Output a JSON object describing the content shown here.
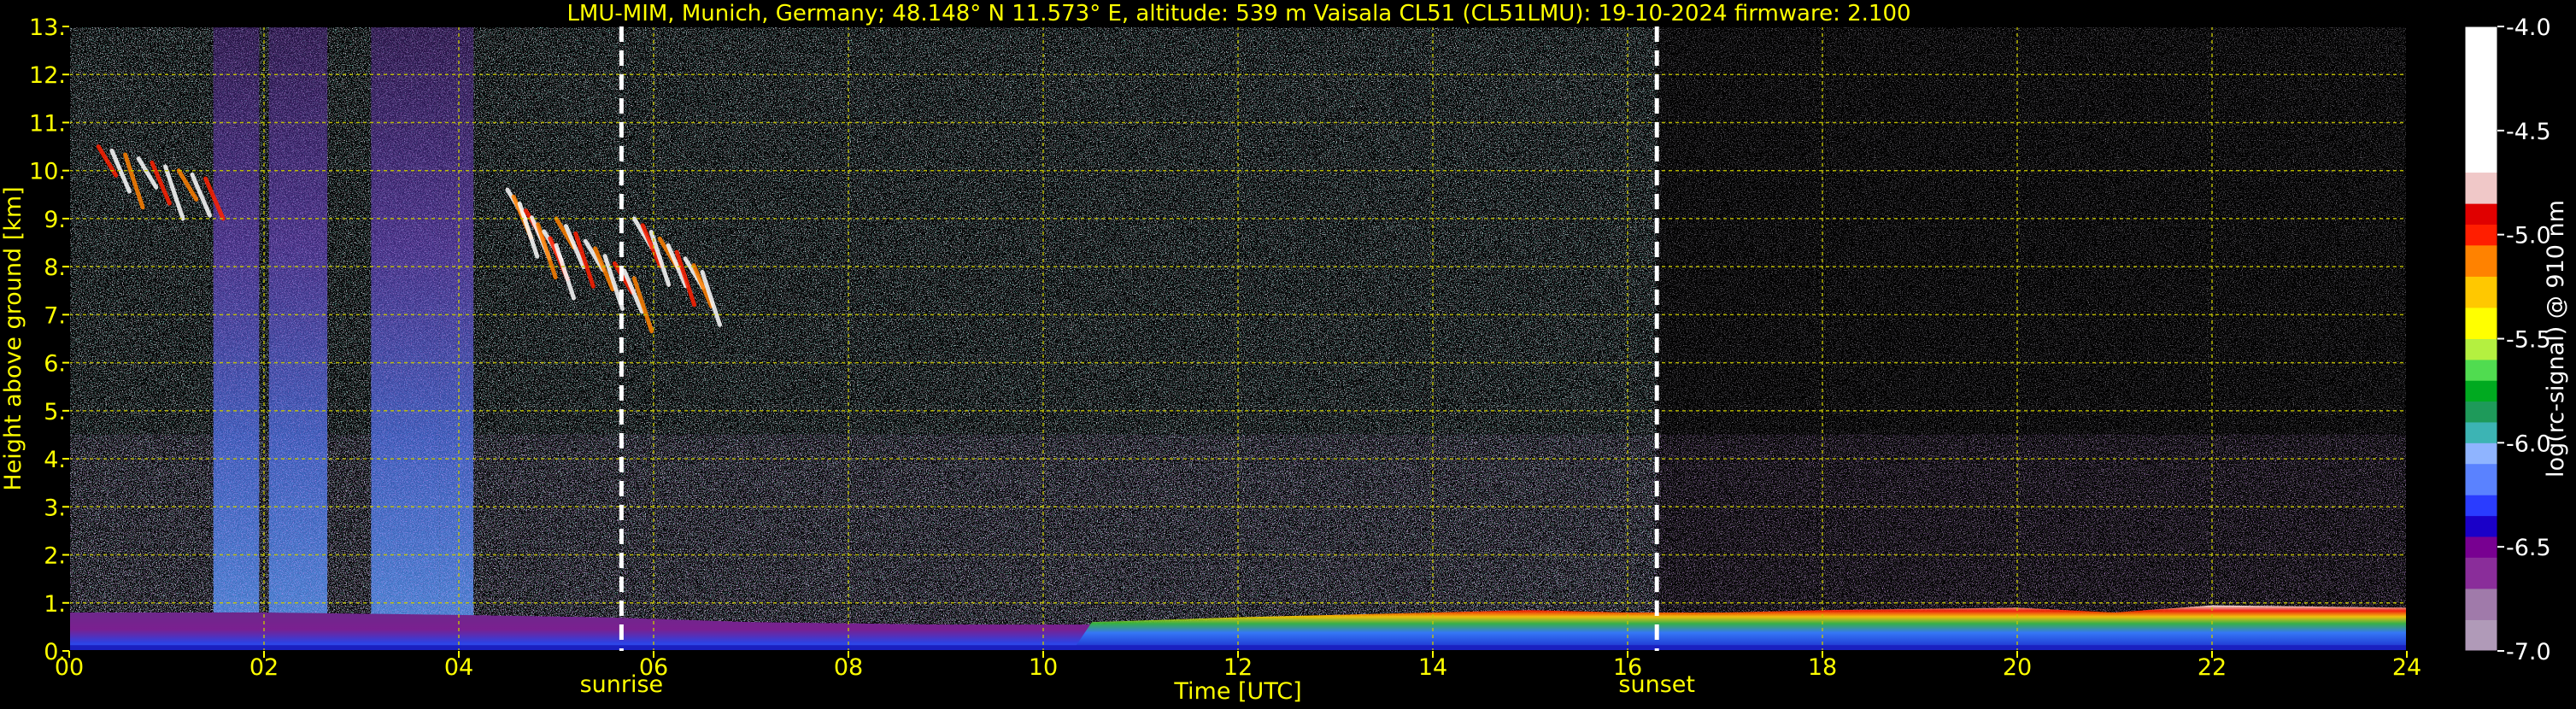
{
  "chart_data": {
    "type": "heatmap",
    "title": "LMU-MIM, Munich, Germany; 48.148° N 11.573° E, altitude: 539 m    Vaisala CL51 (CL51LMU): 19-10-2024    firmware: 2.100",
    "xlabel": "Time [UTC]",
    "ylabel": "Height above ground [km]",
    "xlim": [
      0,
      24
    ],
    "ylim": [
      0,
      13
    ],
    "xticks": [
      {
        "v": 0,
        "label": "00"
      },
      {
        "v": 2,
        "label": "02"
      },
      {
        "v": 4,
        "label": "04"
      },
      {
        "v": 6,
        "label": "06"
      },
      {
        "v": 8,
        "label": "08"
      },
      {
        "v": 10,
        "label": "10"
      },
      {
        "v": 12,
        "label": "12"
      },
      {
        "v": 14,
        "label": "14"
      },
      {
        "v": 16,
        "label": "16"
      },
      {
        "v": 18,
        "label": "18"
      },
      {
        "v": 20,
        "label": "20"
      },
      {
        "v": 22,
        "label": "22"
      },
      {
        "v": 24,
        "label": "24"
      }
    ],
    "yticks": [
      {
        "v": 0,
        "label": "0."
      },
      {
        "v": 1,
        "label": "1."
      },
      {
        "v": 2,
        "label": "2."
      },
      {
        "v": 3,
        "label": "3."
      },
      {
        "v": 4,
        "label": "4."
      },
      {
        "v": 5,
        "label": "5."
      },
      {
        "v": 6,
        "label": "6."
      },
      {
        "v": 7,
        "label": "7."
      },
      {
        "v": 8,
        "label": "8."
      },
      {
        "v": 9,
        "label": "9."
      },
      {
        "v": 10,
        "label": "10."
      },
      {
        "v": 11,
        "label": "11."
      },
      {
        "v": 12,
        "label": "12."
      },
      {
        "v": 13,
        "label": "13."
      }
    ],
    "grid": true,
    "markers": [
      {
        "label": "sunrise",
        "time": 5.67
      },
      {
        "label": "sunset",
        "time": 16.3
      }
    ],
    "colorbar": {
      "label": "log(rc-signal) @ 910 nm",
      "range": [
        -7.0,
        -4.0
      ],
      "ticks": [
        {
          "v": -4.0,
          "label": "-4.0"
        },
        {
          "v": -4.5,
          "label": "-4.5"
        },
        {
          "v": -5.0,
          "label": "-5.0"
        },
        {
          "v": -5.5,
          "label": "-5.5"
        },
        {
          "v": -6.0,
          "label": "-6.0"
        },
        {
          "v": -6.5,
          "label": "-6.5"
        },
        {
          "v": -7.0,
          "label": "-7.0"
        }
      ],
      "colors": [
        {
          "v": -7.0,
          "c": "#b09ab8"
        },
        {
          "v": -6.85,
          "c": "#a07aaa"
        },
        {
          "v": -6.7,
          "c": "#8a2d9a"
        },
        {
          "v": -6.55,
          "c": "#780091"
        },
        {
          "v": -6.45,
          "c": "#1a00c8"
        },
        {
          "v": -6.35,
          "c": "#2a3cff"
        },
        {
          "v": -6.25,
          "c": "#5a82ff"
        },
        {
          "v": -6.1,
          "c": "#8fb4ff"
        },
        {
          "v": -6.0,
          "c": "#3cb4b4"
        },
        {
          "v": -5.9,
          "c": "#1e9a5a"
        },
        {
          "v": -5.8,
          "c": "#00aa20"
        },
        {
          "v": -5.7,
          "c": "#50dc50"
        },
        {
          "v": -5.6,
          "c": "#b4f040"
        },
        {
          "v": -5.5,
          "c": "#ffff00"
        },
        {
          "v": -5.35,
          "c": "#ffc800"
        },
        {
          "v": -5.2,
          "c": "#ff8200"
        },
        {
          "v": -5.05,
          "c": "#ff1e00"
        },
        {
          "v": -4.95,
          "c": "#e00000"
        },
        {
          "v": -4.85,
          "c": "#f0c8c8"
        },
        {
          "v": -4.7,
          "c": "#ffffff"
        },
        {
          "v": -4.0,
          "c": "#ffffff"
        }
      ]
    },
    "features": {
      "boundary_layer_top_km": [
        [
          0,
          0.8
        ],
        [
          2,
          0.8
        ],
        [
          4,
          0.75
        ],
        [
          5.5,
          0.7
        ],
        [
          7,
          0.6
        ],
        [
          9,
          0.55
        ],
        [
          10.5,
          0.55
        ],
        [
          12,
          0.65
        ],
        [
          14,
          0.75
        ],
        [
          15,
          0.8
        ],
        [
          16,
          0.75
        ],
        [
          17,
          0.75
        ],
        [
          18,
          0.8
        ],
        [
          20,
          0.85
        ],
        [
          21,
          0.75
        ],
        [
          22,
          0.9
        ],
        [
          24,
          0.85
        ]
      ],
      "rain_columns_h": [
        [
          1.48,
          1.95
        ],
        [
          2.05,
          2.65
        ],
        [
          3.1,
          3.8
        ],
        [
          3.8,
          4.15
        ]
      ],
      "cirrus_segments": [
        {
          "t0": 0.3,
          "t1": 1.4,
          "h0": 9.0,
          "h1": 10.5
        },
        {
          "t0": 4.5,
          "t1": 5.0,
          "h0": 7.0,
          "h1": 9.6
        },
        {
          "t0": 5.0,
          "t1": 5.8,
          "h0": 6.2,
          "h1": 9.0
        },
        {
          "t0": 5.8,
          "t1": 6.5,
          "h0": 6.5,
          "h1": 9.0
        }
      ]
    },
    "colors": {
      "text": "#ffff00",
      "grid": "#c8c800",
      "marker": "#ffffff",
      "background": "#000000"
    }
  }
}
